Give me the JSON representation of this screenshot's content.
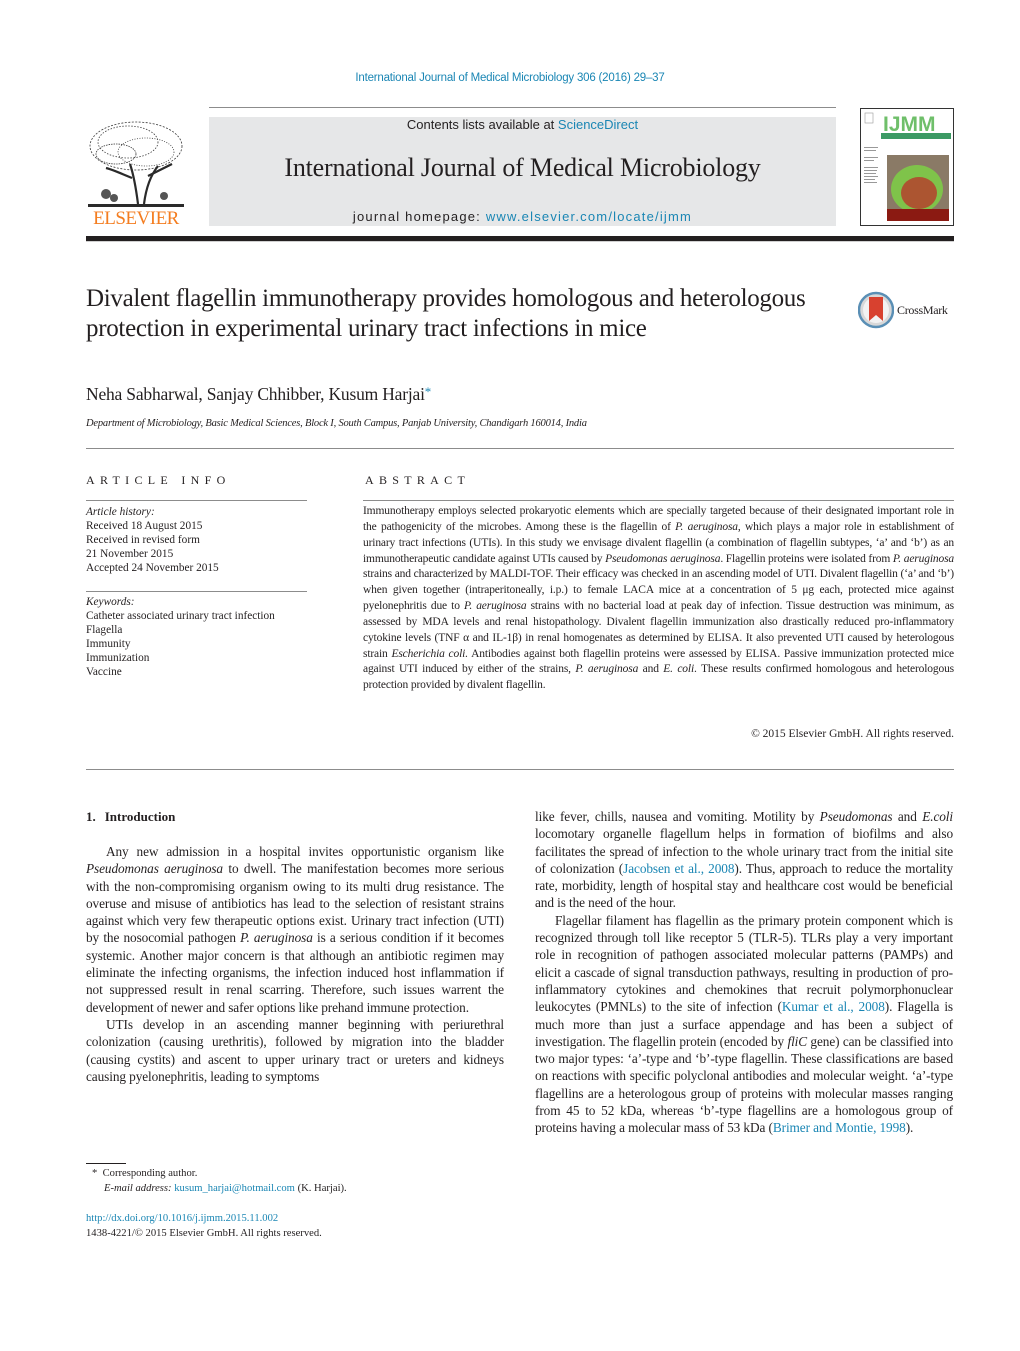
{
  "header": {
    "citation": "International Journal of Medical Microbiology 306 (2016) 29–37",
    "contents_prefix": "Contents lists available at ",
    "contents_link": "ScienceDirect",
    "journal_title": "International Journal of Medical Microbiology",
    "homepage_prefix": "journal homepage: ",
    "homepage_link": "www.elsevier.com/locate/ijmm",
    "publisher_logo_text": "ELSEVIER",
    "cover_logo_text": "IJMM",
    "colors": {
      "link": "#1a86b4",
      "elsevier_orange": "#f47d20",
      "banner_bg": "#e6e7e8"
    }
  },
  "article": {
    "title": "Divalent flagellin immunotherapy provides homologous and heterologous protection in experimental urinary tract infections in mice",
    "crossmark_label": "CrossMark",
    "authors": "Neha Sabharwal, Sanjay Chhibber, Kusum Harjai",
    "corresponding_marker": "*",
    "affiliation": "Department of Microbiology, Basic Medical Sciences, Block I, South Campus, Panjab University, Chandigarh 160014, India"
  },
  "article_info": {
    "heading": "Article Info",
    "history_label": "Article history:",
    "history": [
      "Received 18 August 2015",
      "Received in revised form",
      "21 November 2015",
      "Accepted 24 November 2015"
    ],
    "keywords_label": "Keywords:",
    "keywords": [
      "Catheter associated urinary tract infection",
      "Flagella",
      "Immunity",
      "Immunization",
      "Vaccine"
    ]
  },
  "abstract": {
    "heading": "Abstract",
    "segments": [
      {
        "t": "Immunotherapy employs selected prokaryotic elements which are specially targeted because of their designated important role in the pathogenicity of the microbes. Among these is the flagellin of "
      },
      {
        "i": "P. aeruginosa"
      },
      {
        "t": ", which plays a major role in establishment of urinary tract infections (UTIs). In this study we envisage divalent flagellin (a combination of flagellin subtypes, ‘a’ and ‘b’) as an immunotherapeutic candidate against UTIs caused by "
      },
      {
        "i": "Pseudomonas aeruginosa"
      },
      {
        "t": ". Flagellin proteins were isolated from "
      },
      {
        "i": "P. aeruginosa"
      },
      {
        "t": " strains and characterized by MALDI-TOF. Their efficacy was checked in an ascending model of UTI. Divalent flagellin (‘a’ and ‘b’) when given together (intraperitoneally, i.p.) to female LACA mice at a concentration of 5 μg each, protected mice against pyelonephritis due to "
      },
      {
        "i": "P. aeruginosa"
      },
      {
        "t": " strains with no bacterial load at peak day of infection. Tissue destruction was minimum, as assessed by MDA levels and renal histopathology. Divalent flagellin immunization also drastically reduced pro-inflammatory cytokine levels (TNF α and IL-1β) in renal homogenates as determined by ELISA. It also prevented UTI caused by heterologous strain "
      },
      {
        "i": "Escherichia coli."
      },
      {
        "t": " Antibodies against both flagellin proteins were assessed by ELISA. Passive immunization protected mice against UTI induced by either of the strains, "
      },
      {
        "i": "P. aeruginosa"
      },
      {
        "t": " and "
      },
      {
        "i": "E. coli"
      },
      {
        "t": ". These results confirmed homologous and heterologous protection provided by divalent flagellin."
      }
    ],
    "copyright": "© 2015 Elsevier GmbH. All rights reserved."
  },
  "body": {
    "section_number": "1.",
    "section_title": "Introduction",
    "left_column": [
      {
        "indent": true,
        "segments": [
          {
            "t": "Any new admission in a hospital invites opportunistic organism like "
          },
          {
            "i": "Pseudomonas aeruginosa"
          },
          {
            "t": " to dwell. The manifestation becomes more serious with the non-compromising organism owing to its multi drug resistance. The overuse and misuse of antibiotics has lead to the selection of resistant strains against which very few therapeutic options exist. Urinary tract infection (UTI) by the nosocomial pathogen "
          },
          {
            "i": "P. aeruginosa"
          },
          {
            "t": " is a serious condition if it becomes systemic. Another major concern is that although an antibiotic regimen may eliminate the infecting organisms, the infection induced host inflammation if not suppressed result in renal scarring. Therefore, such issues warrent the development of newer and safer options like prehand immune protection."
          }
        ]
      },
      {
        "indent": true,
        "segments": [
          {
            "t": "UTIs develop in an ascending manner beginning with periurethral colonization (causing urethritis), followed by migration into the bladder (causing cystits) and ascent to upper urinary tract or ureters and kidneys causing pyelonephritis, leading to symptoms"
          }
        ]
      }
    ],
    "right_column": [
      {
        "indent": false,
        "segments": [
          {
            "t": "like fever, chills, nausea and vomiting. Motility by "
          },
          {
            "i": "Pseudomonas"
          },
          {
            "t": " and "
          },
          {
            "i": "E.coli"
          },
          {
            "t": " locomotary organelle flagellum helps in formation of biofilms and also facilitates the spread of infection to the whole urinary tract from the initial site of colonization ("
          },
          {
            "l": "Jacobsen et al., 2008"
          },
          {
            "t": "). Thus, approach to reduce the mortality rate, morbidity, length of hospital stay and healthcare cost would be beneficial and is the need of the hour."
          }
        ]
      },
      {
        "indent": true,
        "segments": [
          {
            "t": "Flagellar filament has flagellin as the primary protein component which is recognized through toll like receptor 5 (TLR-5). TLRs play a very important role in recognition of pathogen associated molecular patterns (PAMPs) and elicit a cascade of signal transduction pathways, resulting in production of pro-inflammatory cytokines and chemokines that recruit polymorphonuclear leukocytes (PMNLs) to the site of infection ("
          },
          {
            "l": "Kumar et al., 2008"
          },
          {
            "t": "). Flagella is much more than just a surface appendage and has been a subject of investigation. The flagellin protein (encoded by "
          },
          {
            "i": "fliC"
          },
          {
            "t": " gene) can be classified into two major types: ‘a’-type and ‘b’-type flagellin. These classifications are based on reactions with specific polyclonal antibodies and molecular weight. ‘a’-type flagellins are a heterologous group of proteins with molecular masses ranging from 45 to 52 kDa, whereas ‘b’-type flagellins are a homologous group of proteins having a molecular mass of 53 kDa ("
          },
          {
            "l": "Brimer and Montie, 1998"
          },
          {
            "t": ")."
          }
        ]
      }
    ]
  },
  "footnote": {
    "marker": "*",
    "corresponding": "Corresponding author.",
    "email_label": "E-mail address:",
    "email": "kusum_harjai@hotmail.com",
    "email_suffix": "(K. Harjai)."
  },
  "doi": {
    "link": "http://dx.doi.org/10.1016/j.ijmm.2015.11.002",
    "issn_line": "1438-4221/© 2015 Elsevier GmbH. All rights reserved."
  }
}
